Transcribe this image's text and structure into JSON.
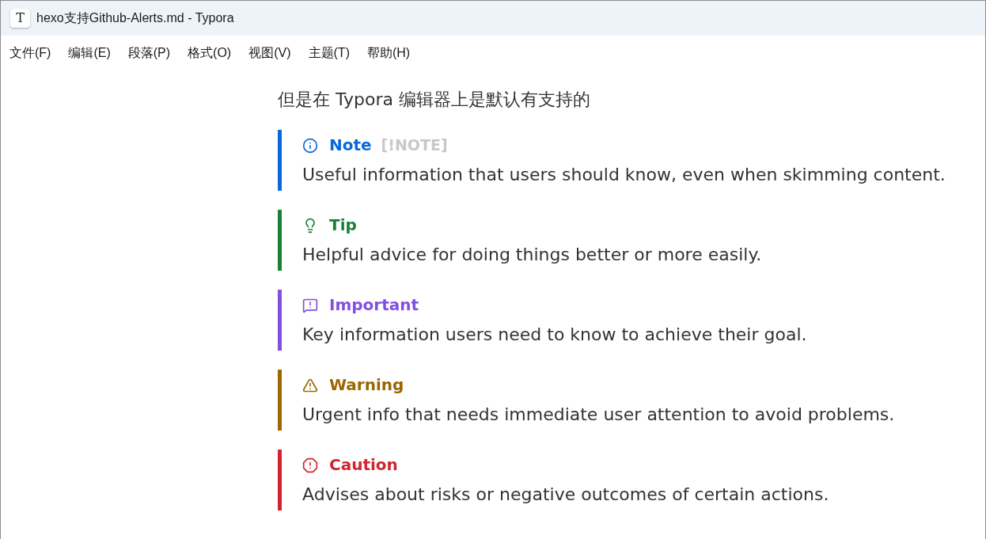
{
  "window": {
    "app_icon_letter": "T",
    "title": "hexo支持Github-Alerts.md - Typora"
  },
  "menu": [
    "文件(F)",
    "编辑(E)",
    "段落(P)",
    "格式(O)",
    "视图(V)",
    "主题(T)",
    "帮助(H)"
  ],
  "document": {
    "paragraph": "但是在 Typora 编辑器上是默认有支持的",
    "alerts": [
      {
        "kind": "note",
        "color": "#0969da",
        "title": "Note",
        "marker": "[!NOTE]",
        "text": "Useful information that users should know, even when skimming content."
      },
      {
        "kind": "tip",
        "color": "#1a7f37",
        "title": "Tip",
        "text": "Helpful advice for doing things better or more easily."
      },
      {
        "kind": "important",
        "color": "#8250df",
        "title": "Important",
        "text": "Key information users need to know to achieve their goal."
      },
      {
        "kind": "warning",
        "color": "#9a6700",
        "title": "Warning",
        "text": "Urgent info that needs immediate user attention to avoid problems."
      },
      {
        "kind": "caution",
        "color": "#d1242f",
        "title": "Caution",
        "text": "Advises about risks or negative outcomes of certain actions."
      }
    ]
  }
}
